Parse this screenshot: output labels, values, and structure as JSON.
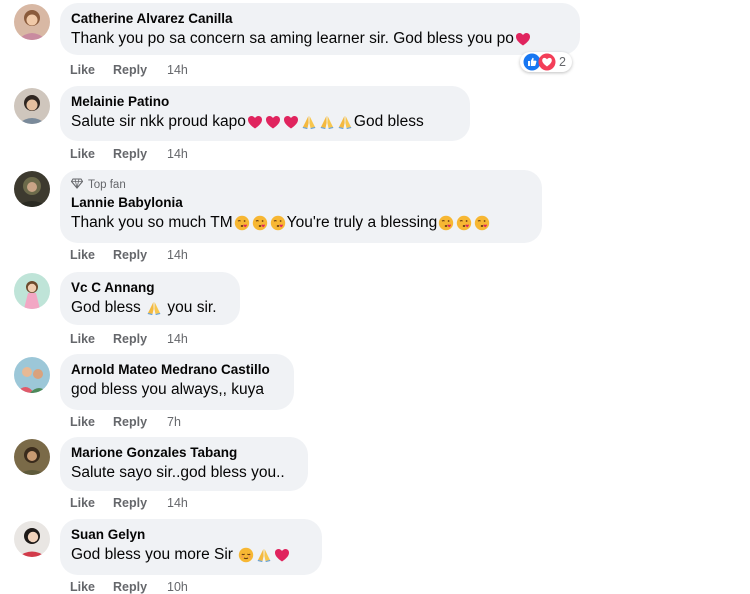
{
  "comments": [
    {
      "name": "Catherine Alvarez Canilla",
      "text": "Thank you po sa concern sa aming learner sir. God bless you po",
      "like": "Like",
      "reply": "Reply",
      "time": "14h",
      "reactions": {
        "count": "2",
        "icons": [
          "like-reaction-icon",
          "love-reaction-icon"
        ]
      }
    },
    {
      "name": "Melainie Patino",
      "text_parts": [
        "Salute sir nkk proud kapo",
        "",
        "God bless"
      ],
      "like": "Like",
      "reply": "Reply",
      "time": "14h"
    },
    {
      "badge": "Top fan",
      "name": "Lannie Babylonia",
      "text_parts": [
        "Thank you so much TM",
        "You're truly a blessing"
      ],
      "like": "Like",
      "reply": "Reply",
      "time": "14h"
    },
    {
      "name": "Vc C Annang",
      "text_parts": [
        "God bless ",
        " you sir."
      ],
      "like": "Like",
      "reply": "Reply",
      "time": "14h"
    },
    {
      "name": "Arnold Mateo Medrano Castillo",
      "text": "god bless you always,, kuya",
      "like": "Like",
      "reply": "Reply",
      "time": "7h"
    },
    {
      "name": "Marione Gonzales Tabang",
      "text": "Salute sayo sir..god bless you..",
      "like": "Like",
      "reply": "Reply",
      "time": "14h"
    },
    {
      "name": "Suan Gelyn",
      "text": "God bless you more Sir",
      "like": "Like",
      "reply": "Reply",
      "time": "10h"
    }
  ],
  "colors": {
    "bubble": "#f0f2f5",
    "secondary_text": "#65676b",
    "like_blue": "#1877f2",
    "love_red": "#f33e58"
  }
}
